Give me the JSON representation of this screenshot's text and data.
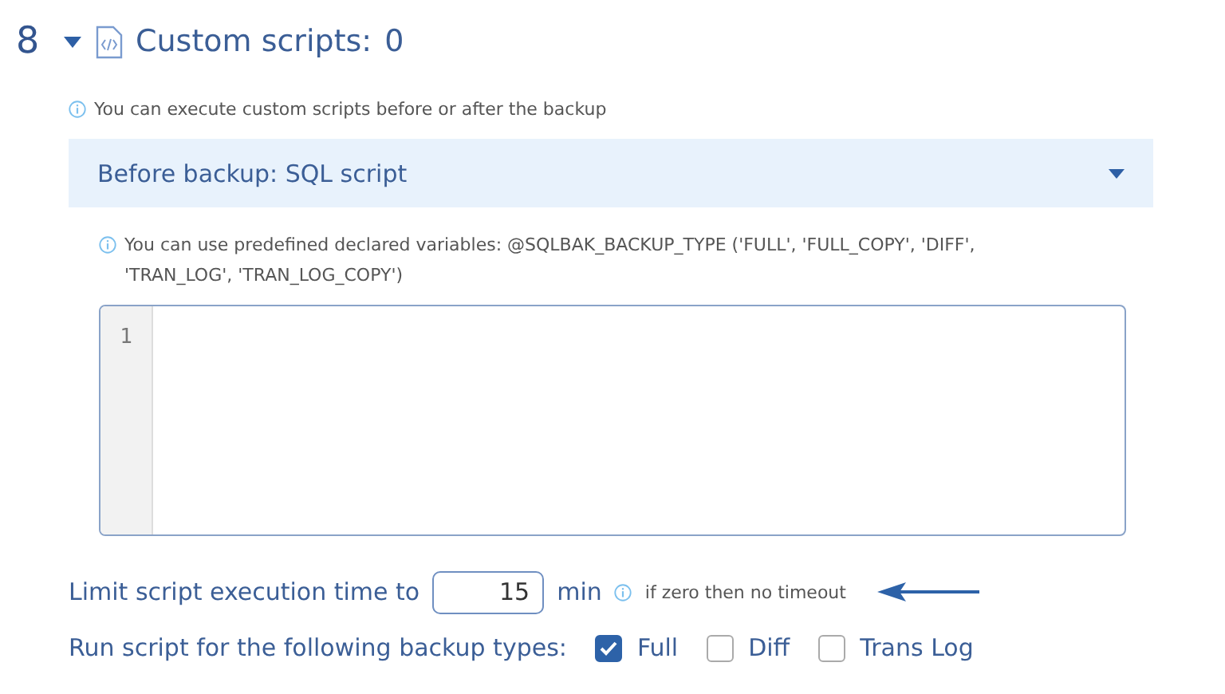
{
  "step": {
    "number": "8",
    "expanded": true,
    "title": "Custom scripts:",
    "count": "0"
  },
  "info": "You can execute custom scripts before or after the backup",
  "dropdown": {
    "value": "Before backup: SQL script"
  },
  "hint": "You can use predefined declared variables: @SQLBAK_BACKUP_TYPE ('FULL', 'FULL_COPY', 'DIFF', 'TRAN_LOG', 'TRAN_LOG_COPY')",
  "editor": {
    "line_numbers": [
      "1"
    ]
  },
  "limit": {
    "label": "Limit script execution time to",
    "value": "15",
    "unit": "min",
    "note": "if zero then no timeout"
  },
  "backup_types": {
    "label": "Run script for the following backup types:",
    "options": [
      {
        "label": "Full",
        "checked": true
      },
      {
        "label": "Diff",
        "checked": false
      },
      {
        "label": "Trans Log",
        "checked": false
      }
    ]
  }
}
